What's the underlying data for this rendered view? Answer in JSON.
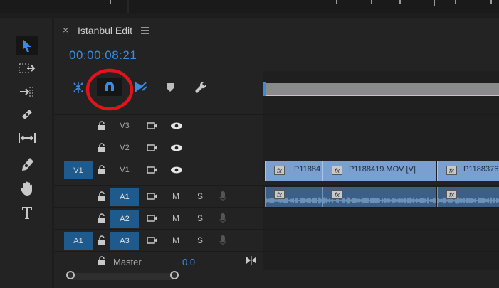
{
  "sequence": {
    "tab_close": "×",
    "title": "Istanbul Edit",
    "menu_icon": "hamburger-menu-icon",
    "timecode": "00:00:08:21"
  },
  "toolbar": {
    "icons": [
      "insert-overwrite-icon",
      "snap-magnet-icon",
      "linked-selection-icon",
      "add-marker-icon",
      "wrench-settings-icon"
    ],
    "highlight_color": "#e1141c",
    "accent_color": "#3b8be0"
  },
  "tools": [
    "selection-tool-icon",
    "track-select-icon",
    "ripple-edit-icon",
    "razor-icon",
    "slip-icon",
    "pen-icon",
    "hand-icon",
    "type-icon"
  ],
  "tracks": [
    {
      "id": "v3",
      "source": "",
      "name": "V3",
      "toggle": "camera-icon",
      "eye": "eye-icon"
    },
    {
      "id": "v2",
      "source": "",
      "name": "V2",
      "toggle": "camera-icon",
      "eye": "eye-icon"
    },
    {
      "id": "v1",
      "source": "V1",
      "name": "V1",
      "toggle": "camera-icon",
      "eye": "eye-icon"
    },
    {
      "id": "a1",
      "source": "",
      "name": "A1",
      "mute": "M",
      "solo": "S"
    },
    {
      "id": "a2",
      "source": "",
      "name": "A2",
      "mute": "M",
      "solo": "S"
    },
    {
      "id": "a3",
      "source": "A1",
      "name": "A3",
      "mute": "M",
      "solo": "S"
    }
  ],
  "master": {
    "label": "Master",
    "value": "0.0"
  },
  "clips": {
    "video": [
      {
        "label": "P11884"
      },
      {
        "label": "P1188419.MOV [V]"
      },
      {
        "label": "P1188376."
      }
    ],
    "fx_label": "fx"
  }
}
